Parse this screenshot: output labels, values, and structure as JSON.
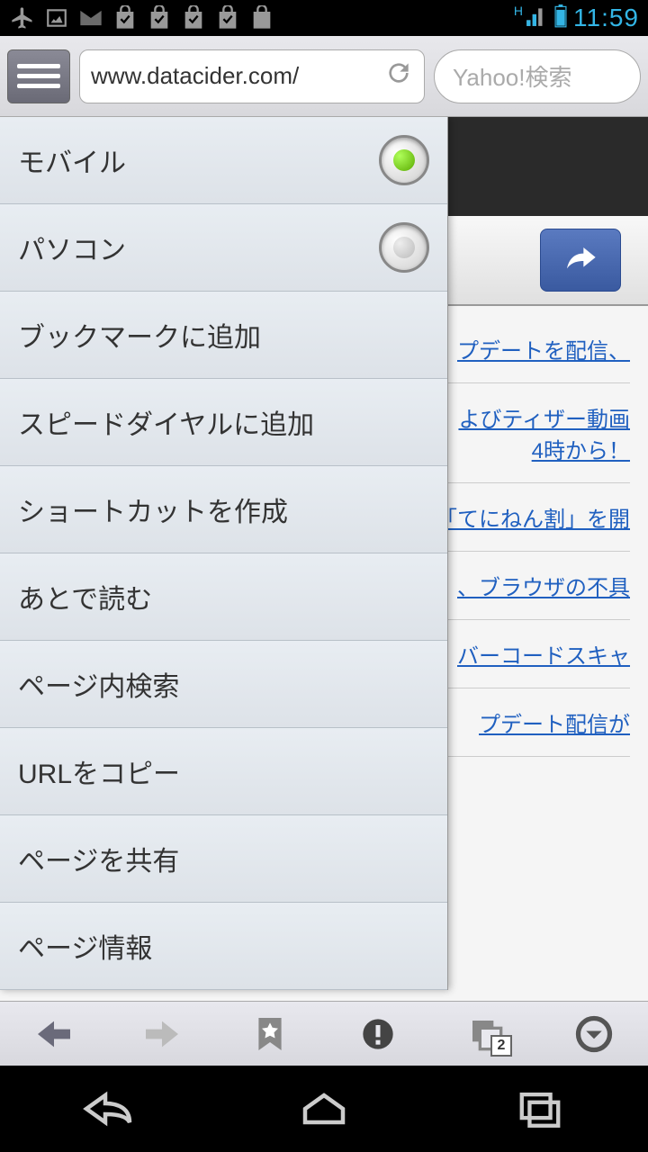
{
  "status": {
    "time": "11:59",
    "signal_label": "H"
  },
  "browser": {
    "url": "www.datacider.com/",
    "search_placeholder": "Yahoo!検索"
  },
  "menu": {
    "items": [
      {
        "label": "モバイル",
        "type": "radio",
        "selected": true
      },
      {
        "label": "パソコン",
        "type": "radio",
        "selected": false
      },
      {
        "label": "ブックマークに追加",
        "type": "action"
      },
      {
        "label": "スピードダイヤルに追加",
        "type": "action"
      },
      {
        "label": "ショートカットを作成",
        "type": "action"
      },
      {
        "label": "あとで読む",
        "type": "action"
      },
      {
        "label": "ページ内検索",
        "type": "action"
      },
      {
        "label": "URLをコピー",
        "type": "action"
      },
      {
        "label": "ページを共有",
        "type": "action"
      },
      {
        "label": "ページ情報",
        "type": "action"
      }
    ]
  },
  "page": {
    "links": [
      "プデートを配信、",
      "よびティザー動画\n4時から！",
      "「てにねん割」を開",
      "、ブラウザの不具",
      "バーコードスキャ",
      "プデート配信が"
    ]
  },
  "toolbar": {
    "tab_count": "2"
  }
}
